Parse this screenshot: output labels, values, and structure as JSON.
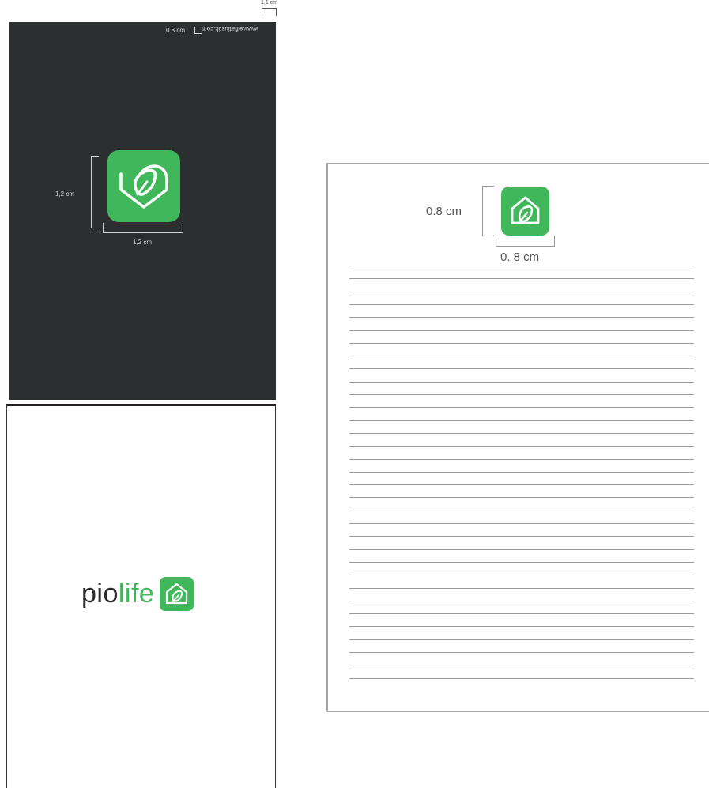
{
  "dark_cover": {
    "url": "www.elfiatiustik.com",
    "margin_label": "0.8 cm",
    "top_dim_label": "1,1 cm",
    "logo_height_label": "1,2 cm",
    "logo_width_label": "1,2 cm"
  },
  "white_cover": {
    "brand_part1": "pio",
    "brand_part2": "life"
  },
  "paper": {
    "logo_height_label": "0.8 cm",
    "logo_width_label": "0. 8 cm",
    "line_count": 33
  },
  "colors": {
    "brand_green": "#3fb75a",
    "dark_bg": "#2b2f30",
    "logo_icon": "leaf-house-icon"
  }
}
